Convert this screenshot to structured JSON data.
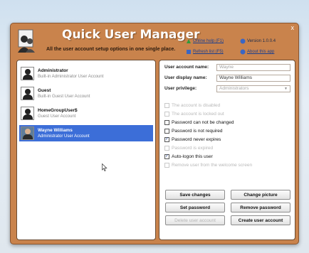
{
  "window": {
    "close_glyph": "x",
    "title": "Quick User Manager",
    "subtitle": "All the user account setup options in one single place.",
    "links": {
      "online_help": "Online help (F1)",
      "version": "Version 1.0.0.4",
      "refresh": "Refresh list (F5)",
      "about": "About this app"
    }
  },
  "users": [
    {
      "name": "Administrator",
      "description": "Built-in Administrator User Account",
      "selected": false,
      "avatar": "default-avatar-icon"
    },
    {
      "name": "Guest",
      "description": "Built-in Guest User Account",
      "selected": false,
      "avatar": "default-avatar-icon"
    },
    {
      "name": "HomeGroupUser$",
      "description": "Guest User Account",
      "selected": false,
      "avatar": "default-avatar-icon"
    },
    {
      "name": "Wayne Williams",
      "description": "Administrator User Account",
      "selected": true,
      "avatar": "photo-avatar-icon"
    }
  ],
  "account": {
    "account_name_label": "User account name:",
    "account_name_value": "Wayne",
    "display_name_label": "User display name:",
    "display_name_value": "Wayne Williams",
    "privilege_label": "User privilege:",
    "privilege_value": "Administrators"
  },
  "options": [
    {
      "label": "The account is disabled",
      "checked": false,
      "enabled": false
    },
    {
      "label": "The account is locked out",
      "checked": false,
      "enabled": false
    },
    {
      "label": "Password can not be changed",
      "checked": false,
      "enabled": true
    },
    {
      "label": "Password is not required",
      "checked": false,
      "enabled": true
    },
    {
      "label": "Password never expires",
      "checked": true,
      "enabled": true
    },
    {
      "label": "Password is expired",
      "checked": false,
      "enabled": false
    },
    {
      "label": "Auto-logon this user",
      "checked": true,
      "enabled": true
    },
    {
      "label": "Remove user from the welcome screen",
      "checked": false,
      "enabled": false
    }
  ],
  "buttons": {
    "save_changes": "Save changes",
    "change_picture": "Change picture",
    "set_password": "Set password",
    "remove_password": "Remove password",
    "delete_account": "Delete user account",
    "create_account": "Create user account"
  },
  "colors": {
    "window_brown": "#c9834c",
    "selection_blue": "#3c6ed8"
  }
}
